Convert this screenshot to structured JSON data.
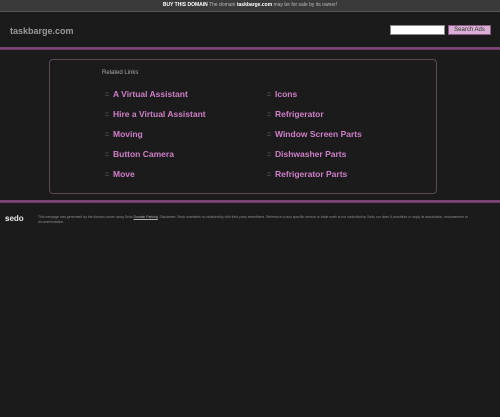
{
  "topbar": {
    "buy_label": "BUY THIS DOMAIN",
    "pre_text": " The domain ",
    "domain": "taskbarge.com",
    "post_text": " may be for sale by its owner!"
  },
  "header": {
    "title": "taskbarge.com",
    "search_placeholder": "",
    "search_button": "Search Ads"
  },
  "related": {
    "title": "Related Links",
    "left_links": [
      "A Virtual Assistant",
      "Hire a Virtual Assistant",
      "Moving",
      "Button Camera",
      "Move"
    ],
    "right_links": [
      "Icons",
      "Refrigerator",
      "Window Screen Parts",
      "Dishwasher Parts",
      "Refrigerator Parts"
    ]
  },
  "footer": {
    "logo_prefix": "s",
    "logo_text": "edo",
    "disclaimer_pre": "This webpage was generated by the domain owner using Sedo ",
    "disclaimer_link": "Domain Parking",
    "disclaimer_post": ". Disclaimer: Sedo maintains no relationship with third party advertisers. Reference to any specific service or trade mark is not controlled by Sedo nor does it constitute or imply its association, endorsement or recommendation."
  },
  "colors": {
    "background": "#1c1b1c",
    "link": "#cf7fc8",
    "accent_line": "#8a4a82",
    "search_button": "#d9b0d4"
  }
}
